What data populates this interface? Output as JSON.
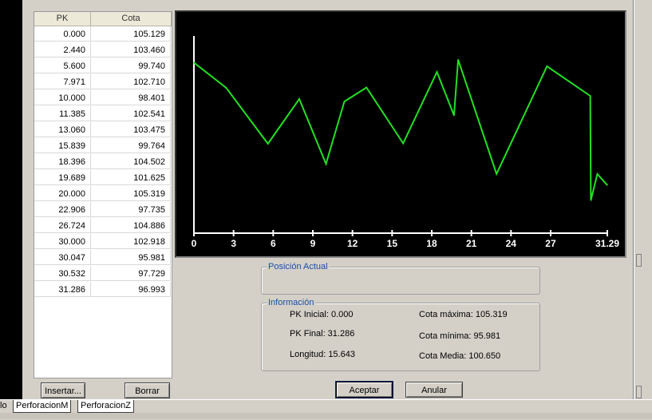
{
  "table": {
    "headers": [
      "PK",
      "Cota"
    ],
    "rows": [
      [
        "0.000",
        "105.129"
      ],
      [
        "2.440",
        "103.460"
      ],
      [
        "5.600",
        "99.740"
      ],
      [
        "7.971",
        "102.710"
      ],
      [
        "10.000",
        "98.401"
      ],
      [
        "11.385",
        "102.541"
      ],
      [
        "13.060",
        "103.475"
      ],
      [
        "15.839",
        "99.764"
      ],
      [
        "18.396",
        "104.502"
      ],
      [
        "19.689",
        "101.625"
      ],
      [
        "20.000",
        "105.319"
      ],
      [
        "22.906",
        "97.735"
      ],
      [
        "26.724",
        "104.886"
      ],
      [
        "30.000",
        "102.918"
      ],
      [
        "30.047",
        "95.981"
      ],
      [
        "30.532",
        "97.729"
      ],
      [
        "31.286",
        "96.993"
      ]
    ]
  },
  "chart_data": {
    "type": "line",
    "x": [
      0.0,
      2.44,
      5.6,
      7.971,
      10.0,
      11.385,
      13.06,
      15.839,
      18.396,
      19.689,
      20.0,
      22.906,
      26.724,
      30.0,
      30.047,
      30.532,
      31.286
    ],
    "y": [
      105.129,
      103.46,
      99.74,
      102.71,
      98.401,
      102.541,
      103.475,
      99.764,
      104.502,
      101.625,
      105.319,
      97.735,
      104.886,
      102.918,
      95.981,
      97.729,
      96.993
    ],
    "x_ticks": [
      "0",
      "3",
      "6",
      "9",
      "12",
      "15",
      "18",
      "21",
      "24",
      "27",
      "31.29"
    ],
    "x_tick_values": [
      0,
      3,
      6,
      9,
      12,
      15,
      18,
      21,
      24,
      27,
      31.29
    ],
    "xlim": [
      0,
      31.29
    ],
    "ylim": [
      93.8,
      106.9
    ],
    "line_color": "#22e022",
    "axis_color": "#ffffff",
    "background": "#000000",
    "grid": false
  },
  "posicion": {
    "legend": "Posición Actual"
  },
  "informacion": {
    "legend": "Información",
    "pk_inicial": "PK Inicial: 0.000",
    "pk_final": "PK Final: 31.286",
    "longitud": "Longitud: 15.643",
    "cota_maxima": "Cota máxima: 105.319",
    "cota_minima": "Cota mínima: 95.981",
    "cota_media": "Cota Media: 100.650"
  },
  "buttons": {
    "insertar": "Insertar...",
    "borrar": "Borrar",
    "aceptar": "Aceptar",
    "anular": "Anular"
  },
  "bottom": {
    "tab1": "lo",
    "tab2": "PerforacionM",
    "tab3": "PerforacionZ"
  }
}
